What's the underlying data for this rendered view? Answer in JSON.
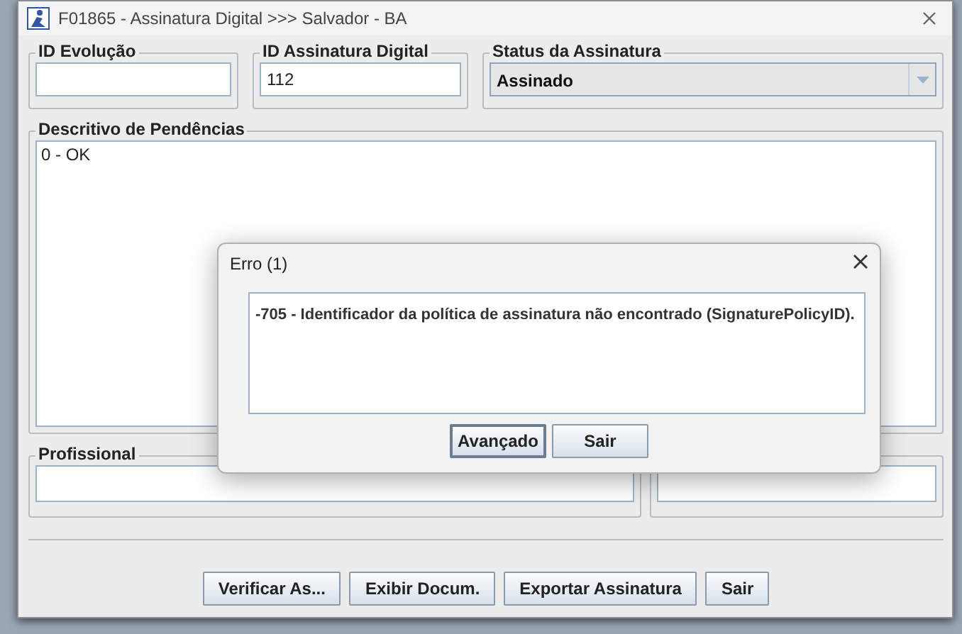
{
  "window": {
    "title": "F01865 - Assinatura Digital >>> Salvador - BA"
  },
  "fields": [
    {
      "label": "ID Evolução",
      "kind": "text"
    },
    {
      "label": "ID Assinatura Digital",
      "kind": "text",
      "value": "112"
    },
    {
      "label": "Status da Assinatura",
      "kind": "combo",
      "value": "Assinado"
    }
  ],
  "pendencias": {
    "label": "Descritivo de Pendências",
    "lines": [
      "0 - OK"
    ]
  },
  "profissional": {
    "label": "Profissional"
  },
  "buttons": [
    "Verificar As...",
    "Exibir Docum.",
    "Exportar Assinatura",
    "Sair"
  ],
  "dialog": {
    "title": "Erro (1)",
    "message": "-705 - Identificador da política de assinatura não encontrado (SignaturePolicyID).",
    "buttons": [
      {
        "label": "Avançado",
        "focused": true
      },
      {
        "label": "Sair",
        "focused": false
      }
    ]
  }
}
